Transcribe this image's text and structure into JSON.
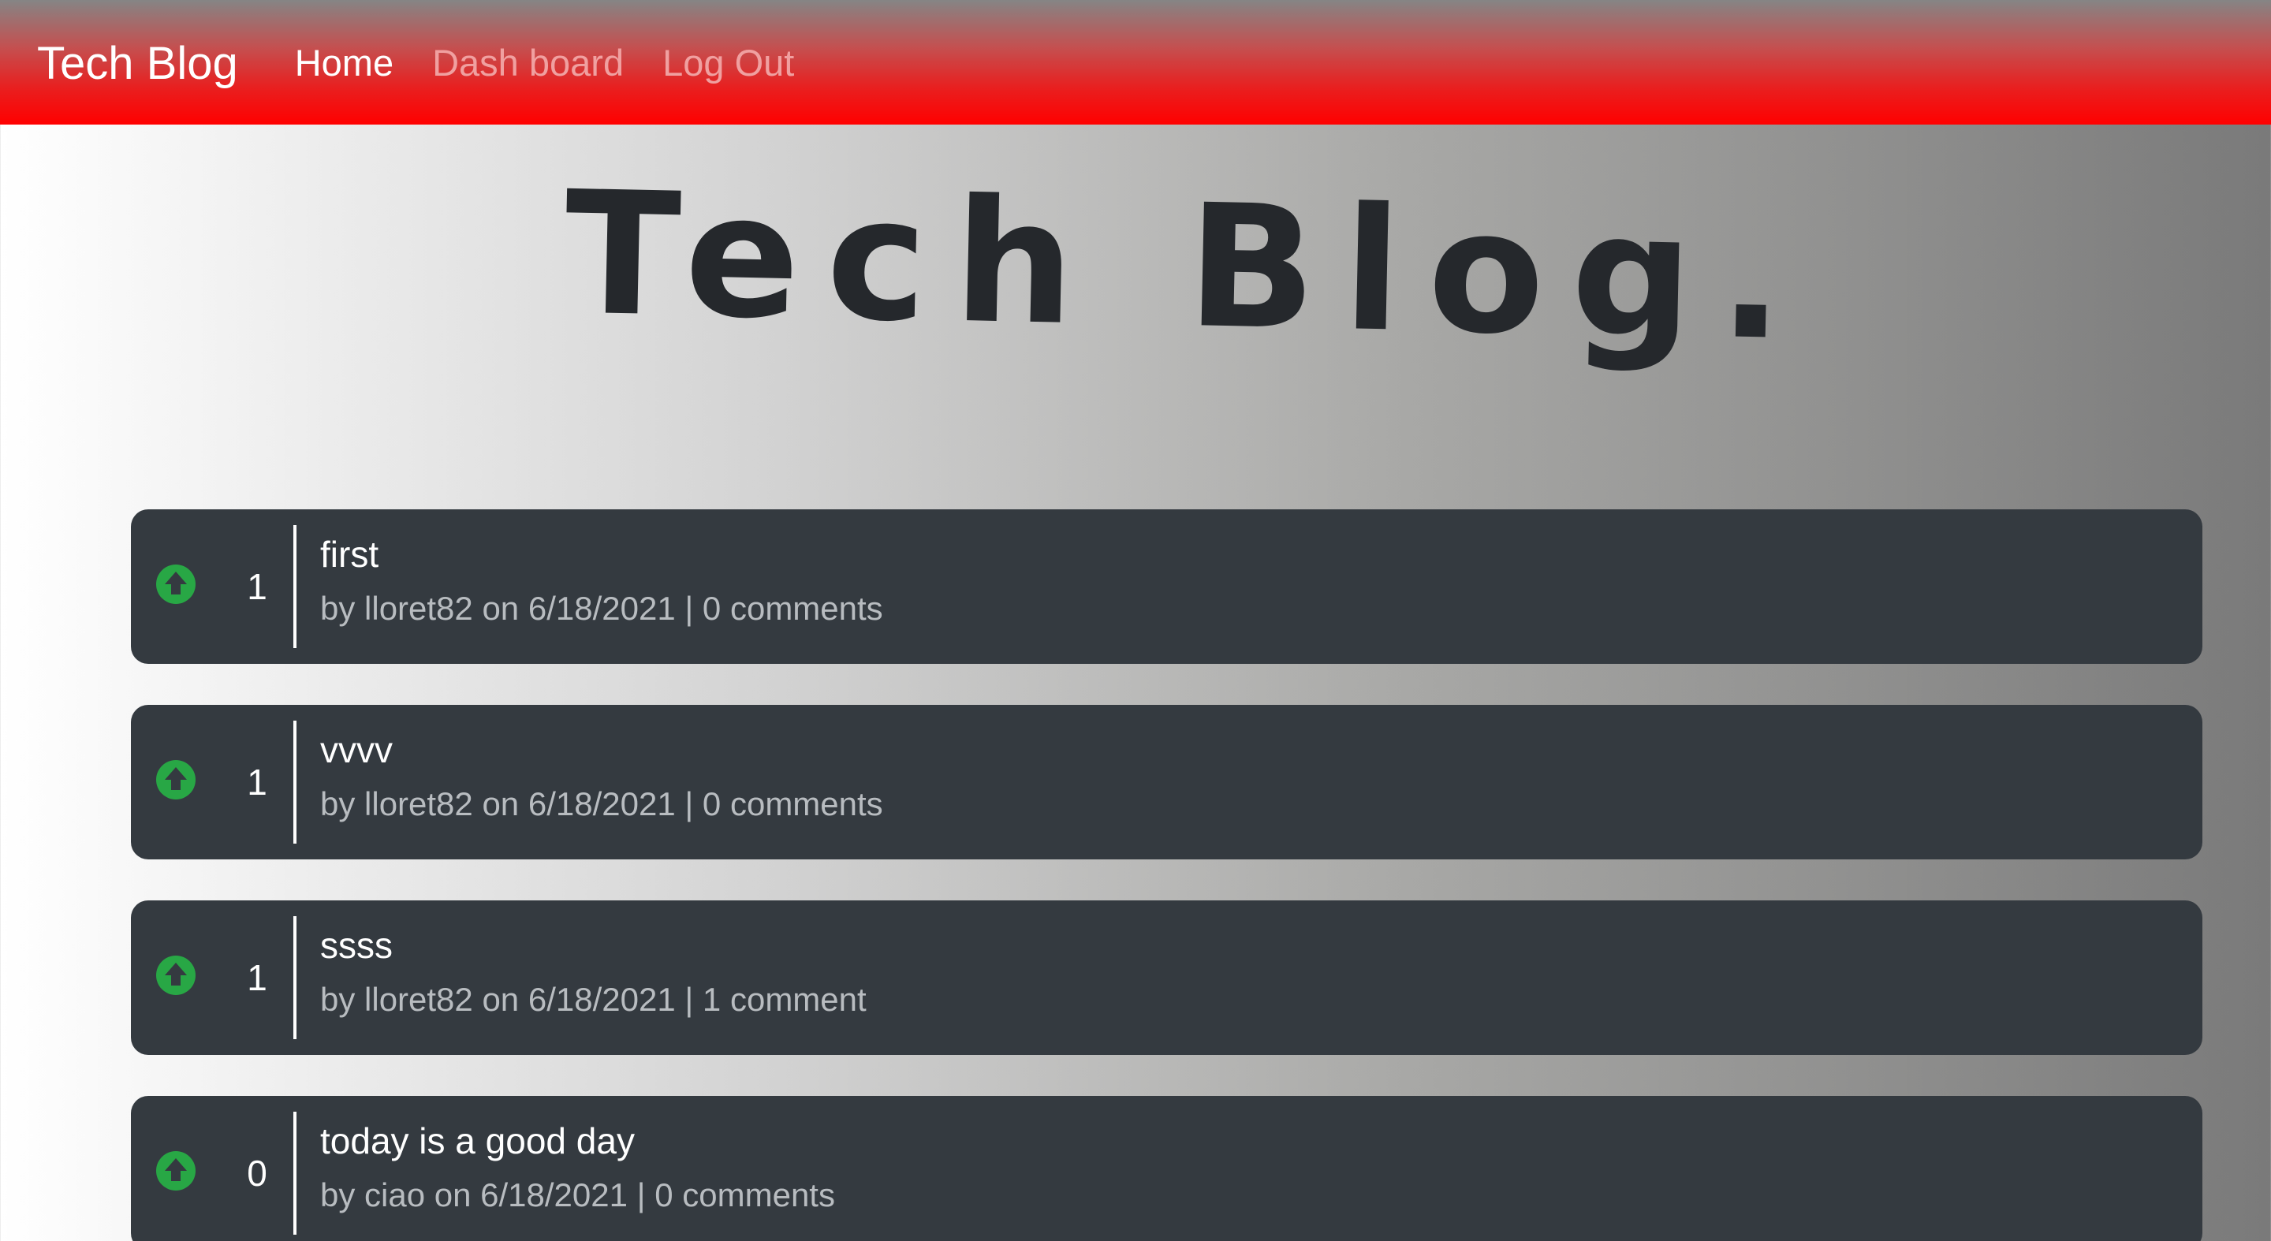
{
  "navbar": {
    "brand": "Tech Blog",
    "links": [
      {
        "label": "Home",
        "active": true
      },
      {
        "label": "Dash board",
        "active": false
      },
      {
        "label": "Log Out",
        "active": false
      }
    ]
  },
  "hero": {
    "title": "Tech Blog."
  },
  "colors": {
    "nav_accent": "#ff0000",
    "card_bg": "#343a40",
    "upvote_icon": "#28a745"
  },
  "posts": [
    {
      "votes": "1",
      "title": "first",
      "meta": "by lloret82 on 6/18/2021 | 0 comments",
      "icon": "arrow-up-circle-icon"
    },
    {
      "votes": "1",
      "title": "vvvv",
      "meta": "by lloret82 on 6/18/2021 | 0 comments",
      "icon": "arrow-up-circle-icon"
    },
    {
      "votes": "1",
      "title": "ssss",
      "meta": "by lloret82 on 6/18/2021 | 1 comment",
      "icon": "arrow-up-circle-icon"
    },
    {
      "votes": "0",
      "title": "today is a good day",
      "meta": "by ciao on 6/18/2021 | 0 comments",
      "icon": "arrow-up-circle-icon"
    }
  ]
}
